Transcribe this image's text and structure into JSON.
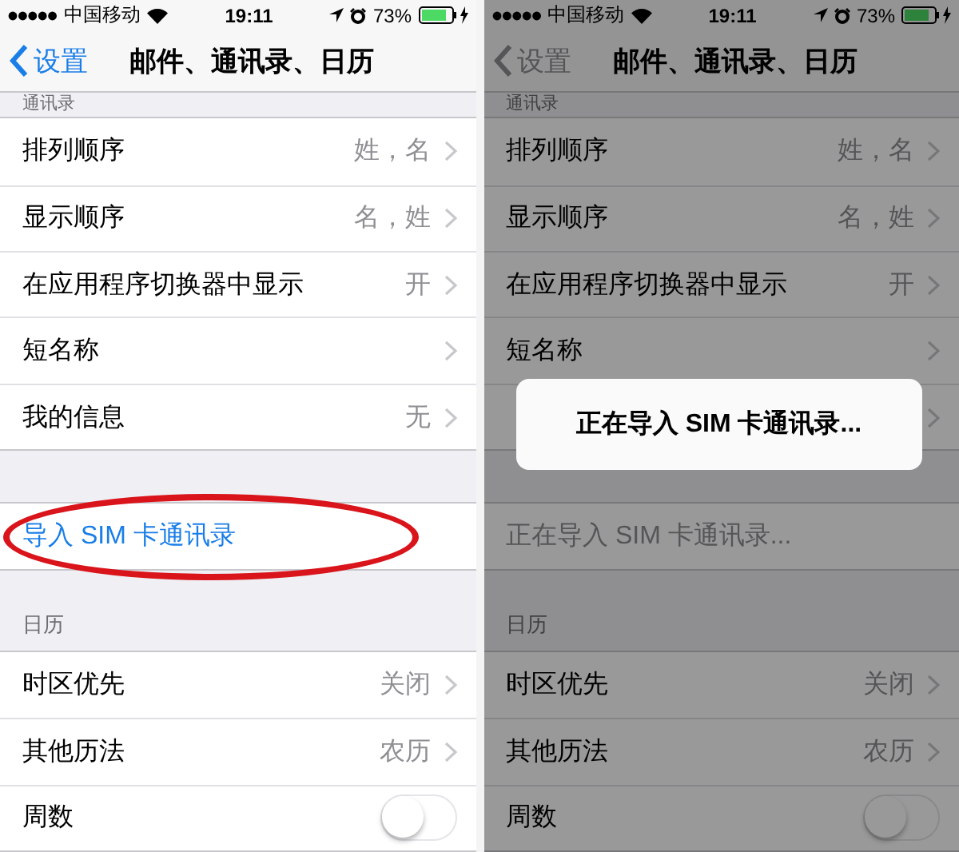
{
  "screens": [
    {
      "dimmed": false,
      "status_bar": {
        "carrier": "中国移动",
        "time": "19:11",
        "battery": "73%"
      },
      "nav": {
        "back": "设置",
        "title": "邮件、通讯录、日历"
      },
      "sections": [
        {
          "header": "通讯录",
          "header_cut": true,
          "rows": [
            {
              "kind": "detail",
              "label": "排列顺序",
              "value": "姓，名"
            },
            {
              "kind": "detail",
              "label": "显示顺序",
              "value": "名，姓"
            },
            {
              "kind": "detail",
              "label": "在应用程序切换器中显示",
              "value": "开"
            },
            {
              "kind": "detail",
              "label": "短名称"
            },
            {
              "kind": "detail",
              "label": "我的信息",
              "value": "无"
            }
          ]
        },
        {
          "rows": [
            {
              "kind": "action",
              "label": "导入 SIM 卡通讯录",
              "disabled": false,
              "annotated": true
            }
          ]
        },
        {
          "header": "日历",
          "header_cut": false,
          "rows": [
            {
              "kind": "detail",
              "label": "时区优先",
              "value": "关闭"
            },
            {
              "kind": "detail",
              "label": "其他历法",
              "value": "农历"
            },
            {
              "kind": "toggle",
              "label": "周数",
              "on": false
            }
          ]
        }
      ]
    },
    {
      "dimmed": true,
      "status_bar": {
        "carrier": "中国移动",
        "time": "19:11",
        "battery": "73%"
      },
      "nav": {
        "back": "设置",
        "title": "邮件、通讯录、日历"
      },
      "sections": [
        {
          "header": "通讯录",
          "header_cut": true,
          "rows": [
            {
              "kind": "detail",
              "label": "排列顺序",
              "value": "姓，名"
            },
            {
              "kind": "detail",
              "label": "显示顺序",
              "value": "名，姓"
            },
            {
              "kind": "detail",
              "label": "在应用程序切换器中显示",
              "value": "开"
            },
            {
              "kind": "detail",
              "label": "短名称"
            },
            {
              "kind": "detail"
            }
          ]
        },
        {
          "rows": [
            {
              "kind": "action",
              "label": "正在导入 SIM 卡通讯录...",
              "disabled": true,
              "annotated": false
            }
          ]
        },
        {
          "header": "日历",
          "header_cut": false,
          "rows": [
            {
              "kind": "detail",
              "label": "时区优先",
              "value": "关闭"
            },
            {
              "kind": "detail",
              "label": "其他历法",
              "value": "农历"
            },
            {
              "kind": "toggle",
              "label": "周数",
              "on": false
            }
          ]
        }
      ],
      "alert": {
        "message": "正在导入 SIM 卡通讯录..."
      }
    }
  ]
}
